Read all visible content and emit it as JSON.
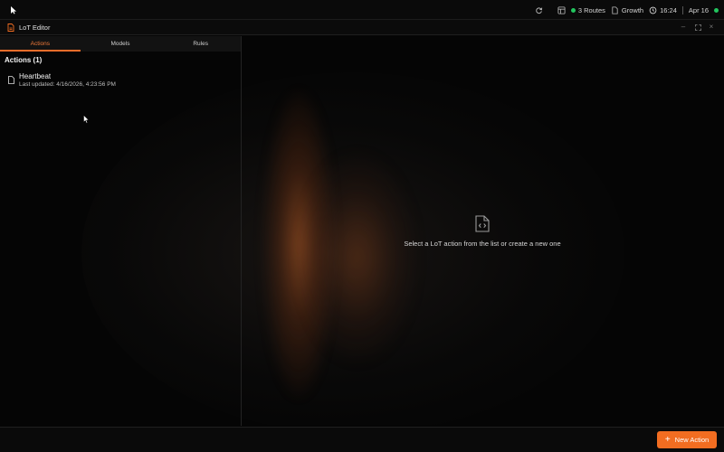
{
  "system_bar": {
    "routes_label": "3 Routes",
    "workspace_label": "Growth",
    "time": "16:24",
    "date": "Apr 16",
    "status_color": "#22c55e",
    "icons": [
      "refresh-icon",
      "layout-icon",
      "document-icon",
      "clock-icon"
    ]
  },
  "window": {
    "title": "LoT Editor",
    "controls": [
      "minimize-icon",
      "maximize-icon",
      "close-icon"
    ]
  },
  "tabs": [
    {
      "label": "Actions",
      "active": true
    },
    {
      "label": "Models",
      "active": false
    },
    {
      "label": "Rules",
      "active": false
    }
  ],
  "sidebar": {
    "section_title": "Actions (1)",
    "items": [
      {
        "name": "Heartbeat",
        "meta": "Last updated: 4/16/2026, 4:23:56 PM"
      }
    ]
  },
  "main": {
    "empty_message": "Select a LoT action from the list or create a new one",
    "empty_icon": "file-code-icon"
  },
  "footer": {
    "new_button_label": "New Action",
    "accent_color": "#f26d21"
  }
}
